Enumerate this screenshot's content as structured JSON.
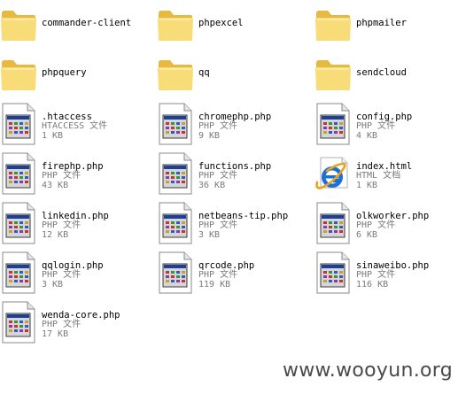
{
  "files": [
    {
      "name": "commander-client",
      "type": "",
      "size": "",
      "icon": "folder-icon"
    },
    {
      "name": "phpexcel",
      "type": "",
      "size": "",
      "icon": "folder-icon"
    },
    {
      "name": "phpmailer",
      "type": "",
      "size": "",
      "icon": "folder-icon"
    },
    {
      "name": "phpquery",
      "type": "",
      "size": "",
      "icon": "folder-icon"
    },
    {
      "name": "qq",
      "type": "",
      "size": "",
      "icon": "folder-icon"
    },
    {
      "name": "sendcloud",
      "type": "",
      "size": "",
      "icon": "folder-icon"
    },
    {
      "name": ".htaccess",
      "type": "HTACCESS 文件",
      "size": "1 KB",
      "icon": "php-file-icon"
    },
    {
      "name": "chromephp.php",
      "type": "PHP 文件",
      "size": "9 KB",
      "icon": "php-file-icon"
    },
    {
      "name": "config.php",
      "type": "PHP 文件",
      "size": "4 KB",
      "icon": "php-file-icon"
    },
    {
      "name": "firephp.php",
      "type": "PHP 文件",
      "size": "43 KB",
      "icon": "php-file-icon"
    },
    {
      "name": "functions.php",
      "type": "PHP 文件",
      "size": "36 KB",
      "icon": "php-file-icon"
    },
    {
      "name": "index.html",
      "type": "HTML 文档",
      "size": "1 KB",
      "icon": "ie-html-icon"
    },
    {
      "name": "linkedin.php",
      "type": "PHP 文件",
      "size": "12 KB",
      "icon": "php-file-icon"
    },
    {
      "name": "netbeans-tip.php",
      "type": "PHP 文件",
      "size": "3 KB",
      "icon": "php-file-icon"
    },
    {
      "name": "olkworker.php",
      "type": "PHP 文件",
      "size": "6 KB",
      "icon": "php-file-icon"
    },
    {
      "name": "qqlogin.php",
      "type": "PHP 文件",
      "size": "3 KB",
      "icon": "php-file-icon"
    },
    {
      "name": "qrcode.php",
      "type": "PHP 文件",
      "size": "119 KB",
      "icon": "php-file-icon"
    },
    {
      "name": "sinaweibo.php",
      "type": "PHP 文件",
      "size": "116 KB",
      "icon": "php-file-icon"
    },
    {
      "name": "wenda-core.php",
      "type": "PHP 文件",
      "size": "17 KB",
      "icon": "php-file-icon"
    }
  ],
  "watermark": "www.wooyun.org",
  "colors": {
    "folder": "#f6d66e",
    "meta_text": "#7a7a7a",
    "ie_blue": "#1b6fd6"
  }
}
